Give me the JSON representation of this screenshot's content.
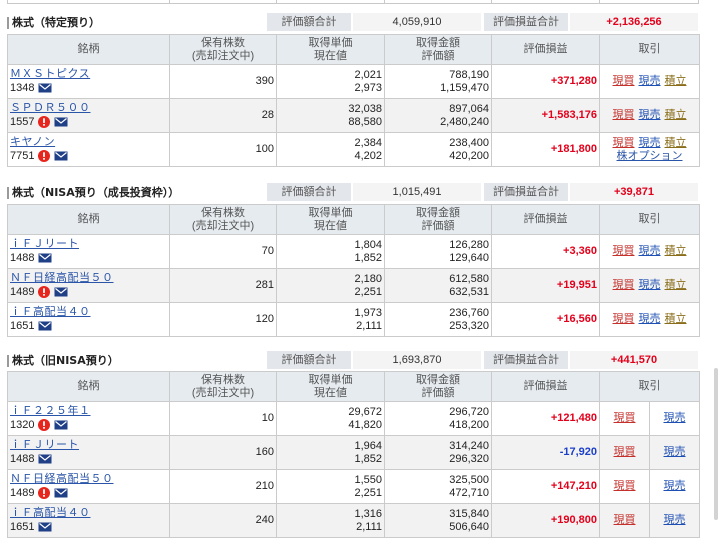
{
  "table_headers": {
    "name": "銘柄",
    "qty": "保有株数",
    "qty_sub": "(売却注文中)",
    "cost": "取得単価",
    "price": "現在値",
    "cost_total": "取得金額",
    "value": "評価額",
    "pl": "評価損益",
    "trade": "取引"
  },
  "summary_labels": {
    "valuation": "評価額合計",
    "pl": "評価損益合計"
  },
  "trade_links": {
    "buy": "現買",
    "sell": "現売",
    "accumulate": "積立",
    "option": "株オプション"
  },
  "colors": {
    "positive_pl": "#e3001b",
    "negative_pl": "#1b3fc9",
    "link": "#2a55a8",
    "buy_link": "#c4302b",
    "sell_link": "#1e4fb3",
    "accumulate_link": "#8a6d1a"
  },
  "sections": [
    {
      "title": "株式（特定預り）",
      "valuation_total": "4,059,910",
      "pl_total": "+2,136,256",
      "rows": [
        {
          "name": "ＭＸＳトピクス",
          "code": "1348",
          "icons": [
            "mail-icon"
          ],
          "qty": "390",
          "cost": "2,021",
          "price": "2,973",
          "cost_total": "788,190",
          "value": "1,159,470",
          "pl": "+371,280"
        },
        {
          "name": "ＳＰＤＲ５００",
          "code": "1557",
          "icons": [
            "alert-icon",
            "mail-icon"
          ],
          "qty": "28",
          "cost": "32,038",
          "price": "88,580",
          "cost_total": "897,064",
          "value": "2,480,240",
          "pl": "+1,583,176"
        },
        {
          "name": "キヤノン",
          "code": "7751",
          "icons": [
            "alert-icon",
            "mail-icon"
          ],
          "qty": "100",
          "cost": "2,384",
          "price": "4,202",
          "cost_total": "238,400",
          "value": "420,200",
          "pl": "+181,800"
        }
      ]
    },
    {
      "title": "株式（NISA預り（成長投資枠））",
      "valuation_total": "1,015,491",
      "pl_total": "+39,871",
      "rows": [
        {
          "name": "ｉＦＪリート",
          "code": "1488",
          "icons": [
            "mail-icon"
          ],
          "qty": "70",
          "cost": "1,804",
          "price": "1,852",
          "cost_total": "126,280",
          "value": "129,640",
          "pl": "+3,360"
        },
        {
          "name": "ＮＦ日経高配当５０",
          "code": "1489",
          "icons": [
            "alert-icon",
            "mail-icon"
          ],
          "qty": "281",
          "cost": "2,180",
          "price": "2,251",
          "cost_total": "612,580",
          "value": "632,531",
          "pl": "+19,951"
        },
        {
          "name": "ｉＦ高配当４０",
          "code": "1651",
          "icons": [
            "mail-icon"
          ],
          "qty": "120",
          "cost": "1,973",
          "price": "2,111",
          "cost_total": "236,760",
          "value": "253,320",
          "pl": "+16,560"
        }
      ]
    },
    {
      "title": "株式（旧NISA預り）",
      "valuation_total": "1,693,870",
      "pl_total": "+441,570",
      "rows": [
        {
          "name": "ｉＦ２２５年１",
          "code": "1320",
          "icons": [
            "alert-icon",
            "mail-icon"
          ],
          "qty": "10",
          "cost": "29,672",
          "price": "41,820",
          "cost_total": "296,720",
          "value": "418,200",
          "pl": "+121,480"
        },
        {
          "name": "ｉＦＪリート",
          "code": "1488",
          "icons": [
            "mail-icon"
          ],
          "qty": "160",
          "cost": "1,964",
          "price": "1,852",
          "cost_total": "314,240",
          "value": "296,320",
          "pl": "-17,920"
        },
        {
          "name": "ＮＦ日経高配当５０",
          "code": "1489",
          "icons": [
            "alert-icon",
            "mail-icon"
          ],
          "qty": "210",
          "cost": "1,550",
          "price": "2,251",
          "cost_total": "325,500",
          "value": "472,710",
          "pl": "+147,210"
        },
        {
          "name": "ｉＦ高配当４０",
          "code": "1651",
          "icons": [
            "mail-icon"
          ],
          "qty": "240",
          "cost": "1,316",
          "price": "2,111",
          "cost_total": "315,840",
          "value": "506,640",
          "pl": "+190,800"
        }
      ]
    }
  ]
}
